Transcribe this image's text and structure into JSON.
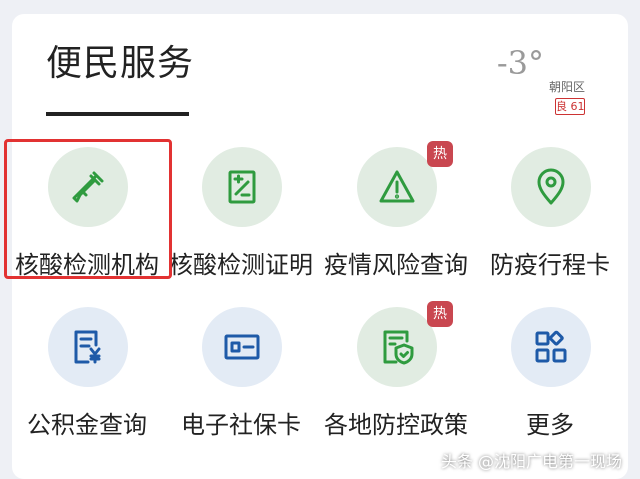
{
  "header": {
    "title": "便民服务"
  },
  "weather": {
    "temperature": "-3°",
    "district": "朝阳区",
    "aqi": "良 61"
  },
  "services": [
    {
      "label": "核酸检测机构",
      "icon": "dropper-icon",
      "hot": false
    },
    {
      "label": "核酸检测证明",
      "icon": "certificate-icon",
      "hot": false
    },
    {
      "label": "疫情风险查询",
      "icon": "warning-icon",
      "hot": true,
      "hot_label": "热"
    },
    {
      "label": "防疫行程卡",
      "icon": "location-pin-icon",
      "hot": false
    },
    {
      "label": "公积金查询",
      "icon": "yuan-document-icon",
      "hot": false
    },
    {
      "label": "电子社保卡",
      "icon": "id-card-icon",
      "hot": false
    },
    {
      "label": "各地防控政策",
      "icon": "shield-document-icon",
      "hot": true,
      "hot_label": "热"
    },
    {
      "label": "更多",
      "icon": "grid-icon",
      "hot": false
    }
  ],
  "watermark": "头条 @沈阳广电第一现场",
  "colors": {
    "green": "#2f9b3f",
    "blue": "#1e5aa8",
    "hot_badge": "#c94750",
    "highlight": "#e23232"
  }
}
